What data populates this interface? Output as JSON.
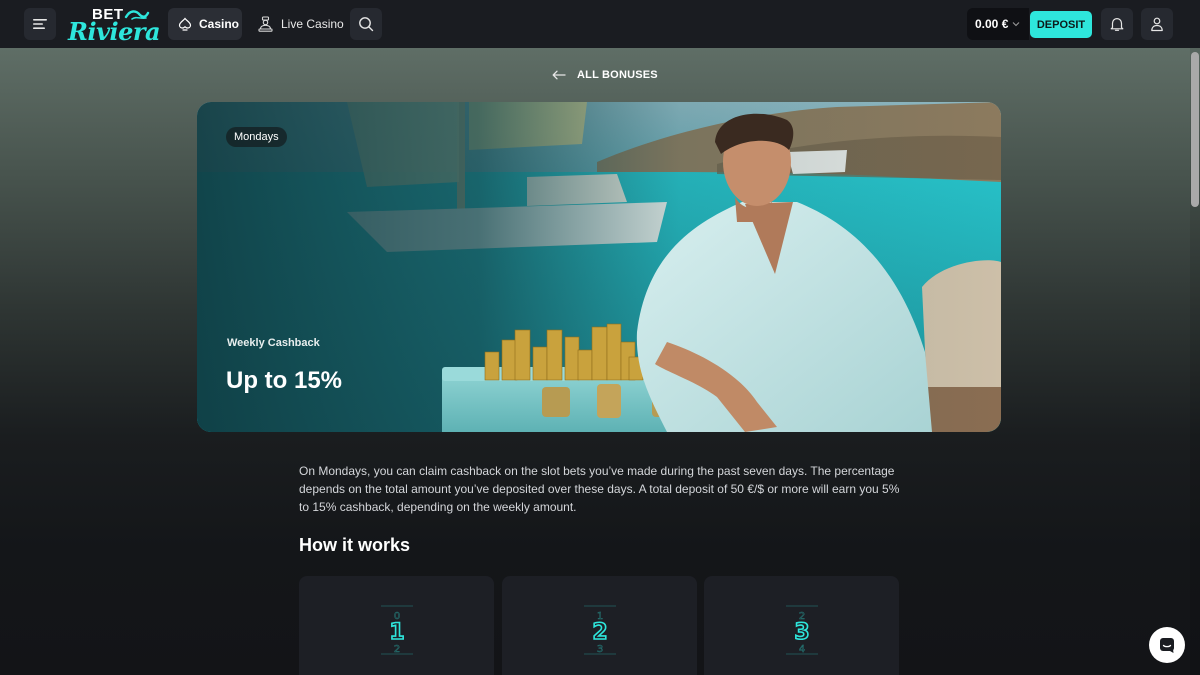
{
  "header": {
    "logo_top": "BET",
    "logo_bottom": "Riviera",
    "nav_casino": "Casino",
    "nav_live_casino": "Live Casino",
    "balance": "0.00 €",
    "deposit_label": "DEPOSIT"
  },
  "back_link": "ALL BONUSES",
  "hero": {
    "tag": "Mondays",
    "subtitle": "Weekly Cashback",
    "title": "Up to 15%"
  },
  "description": "On Mondays, you can claim cashback on the slot bets you’ve made during the past seven days. The percentage depends on the total amount you’ve deposited over these days. A total deposit of 50 €/$ or more will earn you 5% to 15% cashback, depending on the weekly amount.",
  "how_it_works": {
    "title": "How it works",
    "steps": [
      "1",
      "2",
      "3"
    ]
  },
  "colors": {
    "accent": "#2ee6dc",
    "topbar": "#1a1c21",
    "card": "#1d1f25"
  },
  "icons": [
    "menu-icon",
    "spade-icon",
    "dealer-icon",
    "search-icon",
    "chevron-down-icon",
    "bell-icon",
    "user-icon",
    "arrow-left-icon",
    "chat-icon"
  ]
}
